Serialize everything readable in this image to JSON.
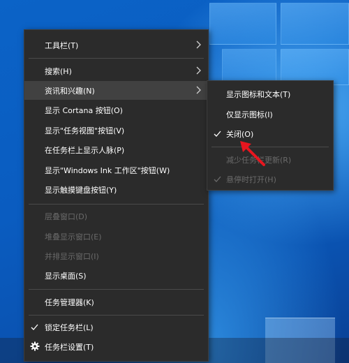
{
  "menu": {
    "items": [
      {
        "label": "工具栏(T)",
        "has_submenu": true,
        "enabled": true
      },
      {
        "label": "搜索(H)",
        "has_submenu": true,
        "enabled": true
      },
      {
        "label": "资讯和兴趣(N)",
        "has_submenu": true,
        "enabled": true,
        "highlighted": true
      },
      {
        "label": "显示 Cortana 按钮(O)",
        "enabled": true
      },
      {
        "label": "显示\"任务视图\"按钮(V)",
        "enabled": true
      },
      {
        "label": "在任务栏上显示人脉(P)",
        "enabled": true
      },
      {
        "label": "显示\"Windows Ink 工作区\"按钮(W)",
        "enabled": true
      },
      {
        "label": "显示触摸键盘按钮(Y)",
        "enabled": true
      },
      {
        "label": "层叠窗口(D)",
        "enabled": false
      },
      {
        "label": "堆叠显示窗口(E)",
        "enabled": false
      },
      {
        "label": "并排显示窗口(I)",
        "enabled": false
      },
      {
        "label": "显示桌面(S)",
        "enabled": true
      },
      {
        "label": "任务管理器(K)",
        "enabled": true
      },
      {
        "label": "锁定任务栏(L)",
        "enabled": true,
        "checked": true
      },
      {
        "label": "任务栏设置(T)",
        "enabled": true,
        "icon": "gear-icon"
      }
    ]
  },
  "submenu": {
    "items": [
      {
        "label": "显示图标和文本(T)",
        "enabled": true
      },
      {
        "label": "仅显示图标(I)",
        "enabled": true
      },
      {
        "label": "关闭(O)",
        "enabled": true,
        "checked": true
      },
      {
        "label": "减少任务栏更新(R)",
        "enabled": false
      },
      {
        "label": "悬停时打开(H)",
        "enabled": false,
        "checked": true
      }
    ]
  },
  "annotation": {
    "type": "red-arrow",
    "points_to": "关闭(O)",
    "color": "#e8161f"
  },
  "colors": {
    "menu_bg": "#2b2b2b",
    "hover_bg": "#414141",
    "text": "#ffffff",
    "disabled_text": "#6a6a6a",
    "desktop": "#0a5cc0"
  }
}
